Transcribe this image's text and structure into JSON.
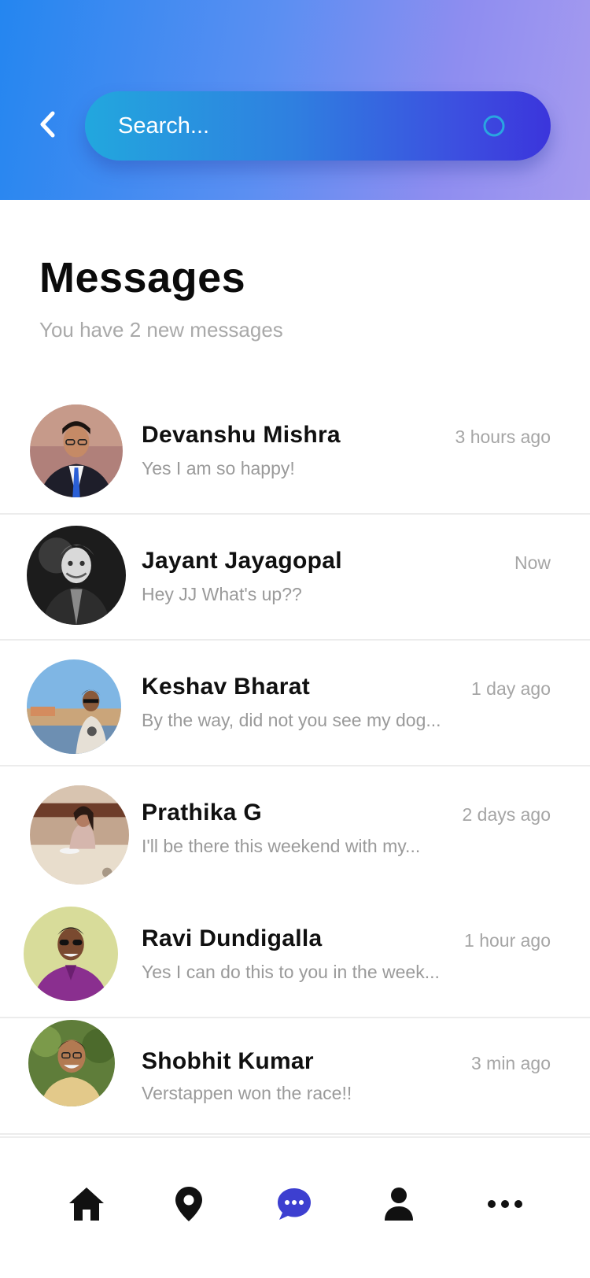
{
  "search": {
    "placeholder": "Search..."
  },
  "messages": {
    "title": "Messages",
    "subtitle": "You have 2 new messages"
  },
  "conversations": [
    {
      "name": "Devanshu Mishra",
      "preview": "Yes I am so happy!",
      "time": "3 hours ago"
    },
    {
      "name": "Jayant Jayagopal",
      "preview": "Hey JJ What's up??",
      "time": "Now"
    },
    {
      "name": "Keshav Bharat",
      "preview": "By the way, did not you see my dog...",
      "time": "1 day ago"
    },
    {
      "name": "Prathika G",
      "preview": "I'll be there this weekend with my...",
      "time": "2 days ago"
    },
    {
      "name": "Ravi Dundigalla",
      "preview": "Yes I can do this to you in the week...",
      "time": "1 hour ago"
    },
    {
      "name": "Shobhit Kumar",
      "preview": "Verstappen won the race!!",
      "time": "3 min ago"
    }
  ],
  "nav": {
    "items": [
      {
        "icon": "home-icon",
        "active": false
      },
      {
        "icon": "location-pin-icon",
        "active": false
      },
      {
        "icon": "chat-icon",
        "active": true
      },
      {
        "icon": "user-icon",
        "active": false
      },
      {
        "icon": "more-icon",
        "active": false
      }
    ],
    "active_color": "#3d3fd0",
    "inactive_color": "#111111"
  },
  "colors": {
    "header_gradient_start": "#2486f0",
    "header_gradient_end": "#a69bef",
    "search_gradient_start": "#22a7de",
    "search_gradient_end": "#3b35dc"
  }
}
